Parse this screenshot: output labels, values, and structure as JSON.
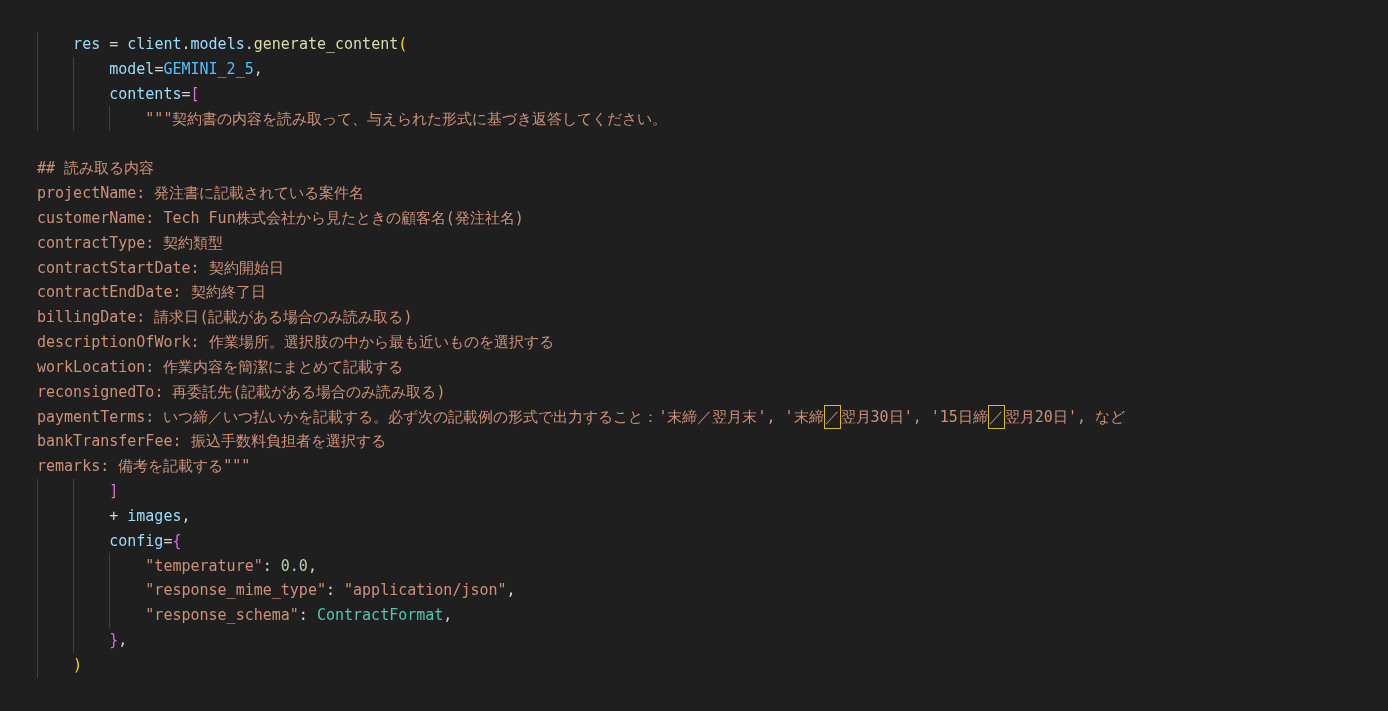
{
  "editor": {
    "lines": [
      {
        "kind": "code",
        "tokens": [
          {
            "kind": "variable",
            "text": "    res"
          },
          {
            "kind": "punctuation",
            "text": " = "
          },
          {
            "kind": "variable",
            "text": "client"
          },
          {
            "kind": "punctuation",
            "text": "."
          },
          {
            "kind": "variable",
            "text": "models"
          },
          {
            "kind": "punctuation",
            "text": "."
          },
          {
            "kind": "function",
            "text": "generate_content"
          },
          {
            "kind": "bracket_outer",
            "text": "("
          }
        ]
      },
      {
        "kind": "code",
        "tokens": [
          {
            "kind": "variable",
            "text": "        model"
          },
          {
            "kind": "punctuation",
            "text": "="
          },
          {
            "kind": "constant",
            "text": "GEMINI_2_5"
          },
          {
            "kind": "punctuation",
            "text": ","
          }
        ]
      },
      {
        "kind": "code",
        "tokens": [
          {
            "kind": "variable",
            "text": "        contents"
          },
          {
            "kind": "punctuation",
            "text": "="
          },
          {
            "kind": "bracket_inner",
            "text": "["
          }
        ]
      },
      {
        "kind": "code",
        "tokens": [
          {
            "kind": "string",
            "text": "            \"\"\"契約書の内容を読み取って、与えられた形式に基づき返答してください。"
          }
        ]
      },
      {
        "kind": "blank"
      },
      {
        "kind": "code",
        "tokens": [
          {
            "kind": "string",
            "text": "## 読み取る内容"
          }
        ]
      },
      {
        "kind": "code",
        "tokens": [
          {
            "kind": "string",
            "text": "projectName: 発注書に記載されている案件名"
          }
        ]
      },
      {
        "kind": "code",
        "tokens": [
          {
            "kind": "string",
            "text": "customerName: Tech Fun株式会社から見たときの顧客名(発注社名)"
          }
        ]
      },
      {
        "kind": "code",
        "tokens": [
          {
            "kind": "string",
            "text": "contractType: 契約類型"
          }
        ]
      },
      {
        "kind": "code",
        "tokens": [
          {
            "kind": "string",
            "text": "contractStartDate: 契約開始日"
          }
        ]
      },
      {
        "kind": "code",
        "tokens": [
          {
            "kind": "string",
            "text": "contractEndDate: 契約終了日"
          }
        ]
      },
      {
        "kind": "code",
        "tokens": [
          {
            "kind": "string",
            "text": "billingDate: 請求日(記載がある場合のみ読み取る)"
          }
        ]
      },
      {
        "kind": "code",
        "tokens": [
          {
            "kind": "string",
            "text": "descriptionOfWork: 作業場所。選択肢の中から最も近いものを選択する"
          }
        ]
      },
      {
        "kind": "code",
        "tokens": [
          {
            "kind": "string",
            "text": "workLocation: 作業内容を簡潔にまとめて記載する"
          }
        ]
      },
      {
        "kind": "code",
        "tokens": [
          {
            "kind": "string",
            "text": "reconsignedTo: 再委託先(記載がある場合のみ読み取る)"
          }
        ]
      },
      {
        "kind": "code",
        "tokens": [
          {
            "kind": "string",
            "text": "paymentTerms: いつ締／いつ払いかを記載する。必ず次の記載例の形式で出力すること：'末締／翌月末', '末締"
          },
          {
            "kind": "string",
            "text": "／",
            "highlighted": true
          },
          {
            "kind": "string",
            "text": "翌月30日', '15日締"
          },
          {
            "kind": "string",
            "text": "／",
            "highlighted": true
          },
          {
            "kind": "string",
            "text": "翌月20日', など"
          }
        ]
      },
      {
        "kind": "code",
        "tokens": [
          {
            "kind": "string",
            "text": "bankTransferFee: 振込手数料負担者を選択する"
          }
        ]
      },
      {
        "kind": "code",
        "tokens": [
          {
            "kind": "string",
            "text": "remarks: 備考を記載する\"\"\""
          }
        ]
      },
      {
        "kind": "code",
        "tokens": [
          {
            "kind": "bracket_inner",
            "text": "        ]"
          }
        ]
      },
      {
        "kind": "code",
        "tokens": [
          {
            "kind": "punctuation",
            "text": "        + "
          },
          {
            "kind": "variable",
            "text": "images"
          },
          {
            "kind": "punctuation",
            "text": ","
          }
        ]
      },
      {
        "kind": "code",
        "tokens": [
          {
            "kind": "variable",
            "text": "        config"
          },
          {
            "kind": "punctuation",
            "text": "="
          },
          {
            "kind": "bracket_inner",
            "text": "{"
          }
        ]
      },
      {
        "kind": "code",
        "tokens": [
          {
            "kind": "string",
            "text": "            \"temperature\""
          },
          {
            "kind": "punctuation",
            "text": ": "
          },
          {
            "kind": "number",
            "text": "0.0"
          },
          {
            "kind": "punctuation",
            "text": ","
          }
        ]
      },
      {
        "kind": "code",
        "tokens": [
          {
            "kind": "string",
            "text": "            \"response_mime_type\""
          },
          {
            "kind": "punctuation",
            "text": ": "
          },
          {
            "kind": "string",
            "text": "\"application/json\""
          },
          {
            "kind": "punctuation",
            "text": ","
          }
        ]
      },
      {
        "kind": "code",
        "tokens": [
          {
            "kind": "string",
            "text": "            \"response_schema\""
          },
          {
            "kind": "punctuation",
            "text": ": "
          },
          {
            "kind": "class",
            "text": "ContractFormat"
          },
          {
            "kind": "punctuation",
            "text": ","
          }
        ]
      },
      {
        "kind": "code",
        "tokens": [
          {
            "kind": "bracket_inner",
            "text": "        }"
          },
          {
            "kind": "punctuation",
            "text": ","
          }
        ]
      },
      {
        "kind": "code",
        "tokens": [
          {
            "kind": "bracket_outer",
            "text": "    )"
          }
        ]
      }
    ]
  }
}
